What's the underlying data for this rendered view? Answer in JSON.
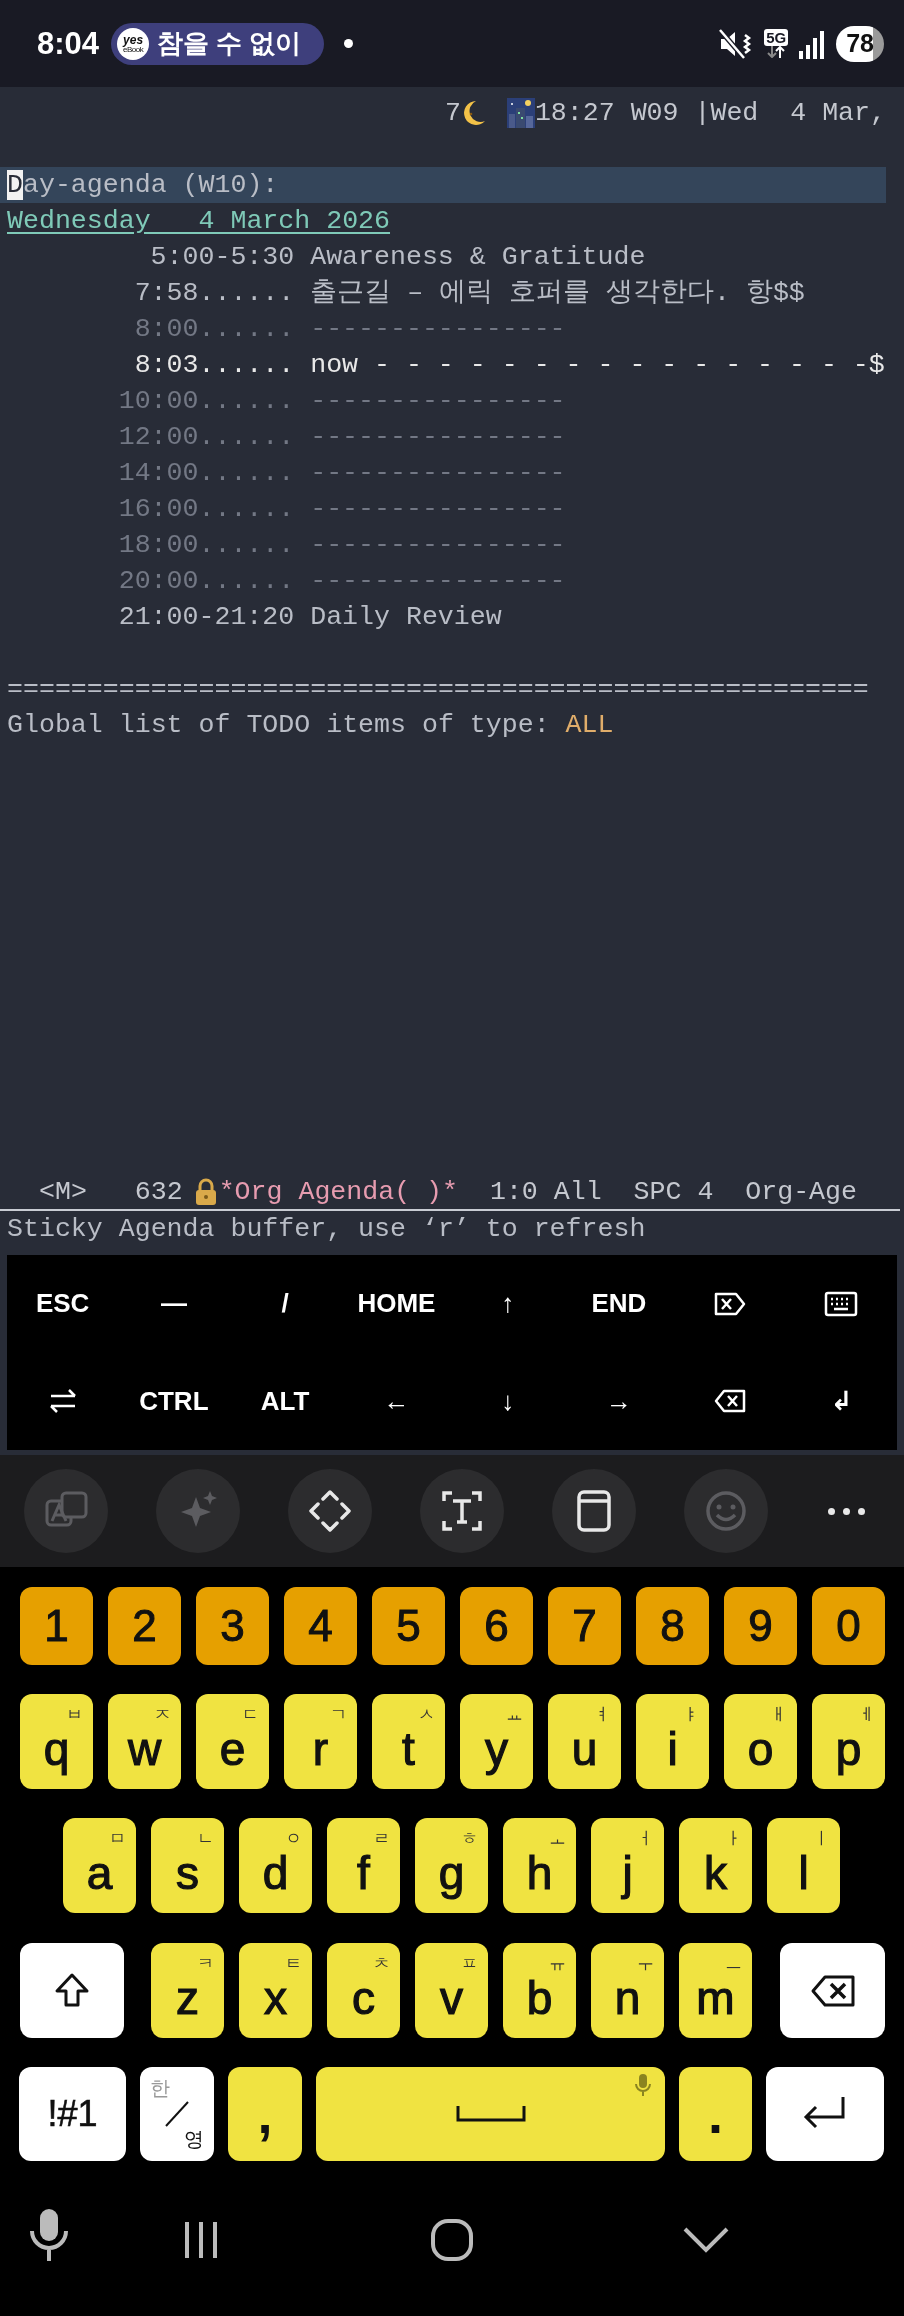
{
  "status_bar": {
    "time": "8:04",
    "notification": {
      "app_logo": [
        "yes",
        "eBook"
      ],
      "text": "참을 수 없이"
    },
    "network": "5G",
    "battery": "78"
  },
  "header_line": {
    "prefix": "7",
    "clock": "18:27 W09 |Wed  4 Mar,"
  },
  "agenda": {
    "title": "Day-agenda (W10):",
    "date": "Wednesday   4 March 2026",
    "entries": [
      {
        "kind": "event",
        "time": "5:00-5:30",
        "text": "Awareness & Gratitude"
      },
      {
        "kind": "event",
        "time": "7:58......",
        "text": "출근길 – 에릭 호퍼를 생각한다. 항$$"
      },
      {
        "kind": "grid",
        "time": "8:00......",
        "text": "----------------"
      },
      {
        "kind": "now",
        "time": "8:03......",
        "text": "now - - - - - - - - - - - - - - - -$"
      },
      {
        "kind": "grid",
        "time": "10:00......",
        "text": "----------------"
      },
      {
        "kind": "grid",
        "time": "12:00......",
        "text": "----------------"
      },
      {
        "kind": "grid",
        "time": "14:00......",
        "text": "----------------"
      },
      {
        "kind": "grid",
        "time": "16:00......",
        "text": "----------------"
      },
      {
        "kind": "grid",
        "time": "18:00......",
        "text": "----------------"
      },
      {
        "kind": "grid",
        "time": "20:00......",
        "text": "----------------"
      },
      {
        "kind": "event",
        "time": "21:00-21:20",
        "text": "Daily Review"
      }
    ],
    "separator": "======================================================",
    "todo_heading": "Global list of TODO items of type:",
    "todo_type": "ALL"
  },
  "mode_line": {
    "state": "<M>",
    "size": "632",
    "buffer": "*Org Agenda( )*",
    "position": "1:0 All",
    "indent": "SPC 4",
    "mode": "Org-Age"
  },
  "echo_area": "Sticky Agenda buffer, use ‘r’ to refresh",
  "extra_keys": [
    [
      {
        "kind": "text",
        "label": "ESC"
      },
      {
        "kind": "text",
        "label": "―"
      },
      {
        "kind": "text",
        "label": "/"
      },
      {
        "kind": "text",
        "label": "HOME"
      },
      {
        "kind": "text",
        "label": "↑"
      },
      {
        "kind": "text",
        "label": "END"
      },
      {
        "kind": "delete"
      },
      {
        "kind": "keyboard"
      }
    ],
    [
      {
        "kind": "tab"
      },
      {
        "kind": "text",
        "label": "CTRL"
      },
      {
        "kind": "text",
        "label": "ALT"
      },
      {
        "kind": "text",
        "label": "←"
      },
      {
        "kind": "text",
        "label": "↓"
      },
      {
        "kind": "text",
        "label": "→"
      },
      {
        "kind": "backspace"
      },
      {
        "kind": "text",
        "label": "↲"
      }
    ]
  ],
  "keyboard_toolbar": [
    {
      "kind": "translate",
      "disabled": true
    },
    {
      "kind": "sparkle",
      "disabled": true
    },
    {
      "kind": "move",
      "disabled": false
    },
    {
      "kind": "text-select",
      "disabled": false
    },
    {
      "kind": "clipboard",
      "disabled": false
    },
    {
      "kind": "emoji",
      "disabled": true
    },
    {
      "kind": "more",
      "disabled": false
    }
  ],
  "keyboard": {
    "number_row": [
      "1",
      "2",
      "3",
      "4",
      "5",
      "6",
      "7",
      "8",
      "9",
      "0"
    ],
    "letter_rows": [
      [
        {
          "key": "q",
          "hint": "ㅂ"
        },
        {
          "key": "w",
          "hint": "ㅈ"
        },
        {
          "key": "e",
          "hint": "ㄷ"
        },
        {
          "key": "r",
          "hint": "ㄱ"
        },
        {
          "key": "t",
          "hint": "ㅅ"
        },
        {
          "key": "y",
          "hint": "ㅛ"
        },
        {
          "key": "u",
          "hint": "ㅕ"
        },
        {
          "key": "i",
          "hint": "ㅑ"
        },
        {
          "key": "o",
          "hint": "ㅐ"
        },
        {
          "key": "p",
          "hint": "ㅔ"
        }
      ],
      [
        {
          "key": "a",
          "hint": "ㅁ"
        },
        {
          "key": "s",
          "hint": "ㄴ"
        },
        {
          "key": "d",
          "hint": "ㅇ"
        },
        {
          "key": "f",
          "hint": "ㄹ"
        },
        {
          "key": "g",
          "hint": "ㅎ"
        },
        {
          "key": "h",
          "hint": "ㅗ"
        },
        {
          "key": "j",
          "hint": "ㅓ"
        },
        {
          "key": "k",
          "hint": "ㅏ"
        },
        {
          "key": "l",
          "hint": "ㅣ"
        }
      ],
      [
        {
          "key": "z",
          "hint": "ㅋ"
        },
        {
          "key": "x",
          "hint": "ㅌ"
        },
        {
          "key": "c",
          "hint": "ㅊ"
        },
        {
          "key": "v",
          "hint": "ㅍ"
        },
        {
          "key": "b",
          "hint": "ㅠ"
        },
        {
          "key": "n",
          "hint": "ㅜ"
        },
        {
          "key": "m",
          "hint": "ㅡ"
        }
      ]
    ],
    "symbols_key": "!#1",
    "language_key": {
      "top": "한",
      "bottom": "영"
    },
    "comma": ",",
    "period": "."
  }
}
